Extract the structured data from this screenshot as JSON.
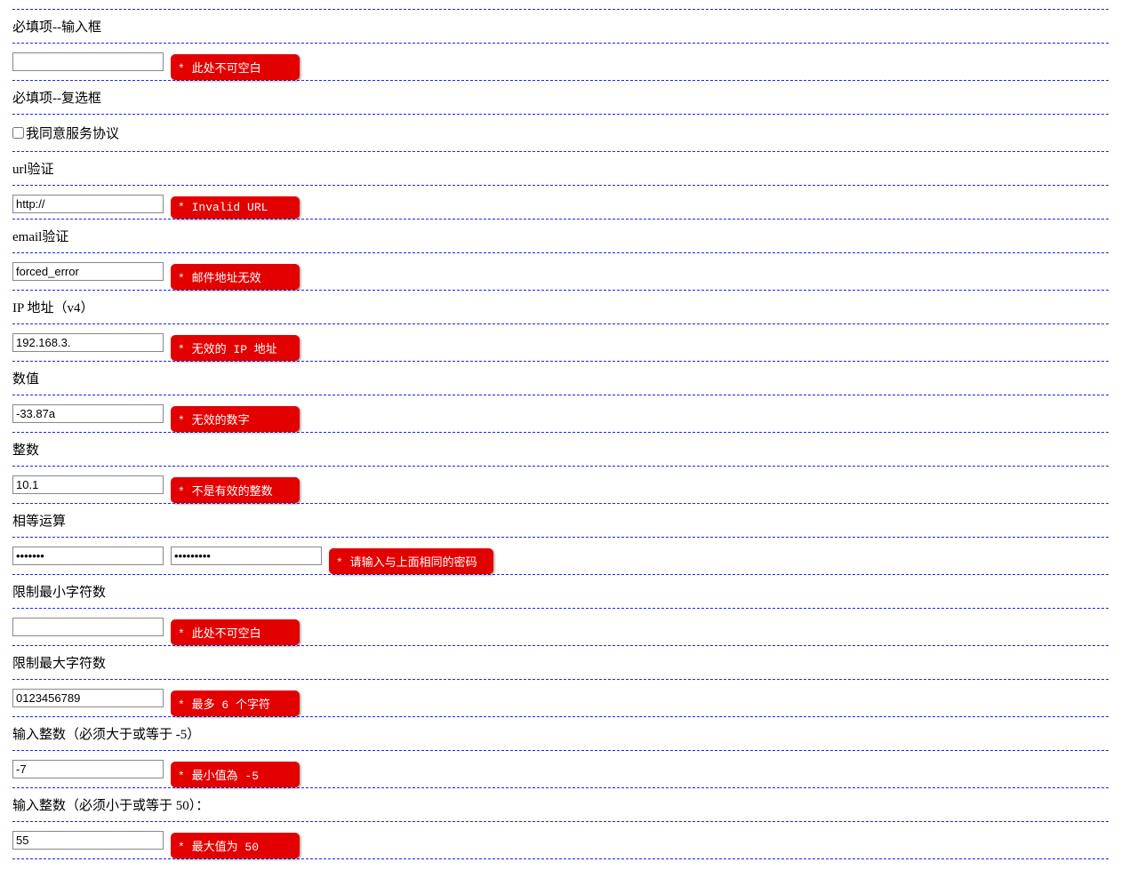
{
  "fields": {
    "required_input": {
      "label": "必填项--输入框",
      "value": "",
      "error": "* 此处不可空白"
    },
    "required_checkbox": {
      "label": "必填项--复选框",
      "checkbox_label": "我同意服务协议"
    },
    "url": {
      "label": "url验证",
      "value": "http://",
      "error": "* Invalid URL"
    },
    "email": {
      "label": "email验证",
      "value": "forced_error",
      "error": "* 邮件地址无效"
    },
    "ip": {
      "label": "IP 地址（v4）",
      "value": "192.168.3.",
      "error": "* 无效的 IP 地址"
    },
    "number": {
      "label": "数值",
      "value": "-33.87a",
      "error": "* 无效的数字"
    },
    "integer": {
      "label": "整数",
      "value": "10.1",
      "error": "* 不是有效的整数"
    },
    "equal": {
      "label": "相等运算",
      "value1": "•••••••",
      "value2": "•••••••••",
      "error": "* 请输入与上面相同的密码"
    },
    "minlen": {
      "label": "限制最小字符数",
      "value": "",
      "error": "* 此处不可空白"
    },
    "maxlen": {
      "label": "限制最大字符数",
      "value": "0123456789",
      "error": "* 最多 6 个字符"
    },
    "min": {
      "label": "输入整数（必须大于或等于 -5）",
      "value": "-7",
      "error": "* 最小值為 -5"
    },
    "max": {
      "label": "输入整数（必须小于或等于 50）：",
      "value": "55",
      "error": "* 最大值为 50"
    }
  }
}
